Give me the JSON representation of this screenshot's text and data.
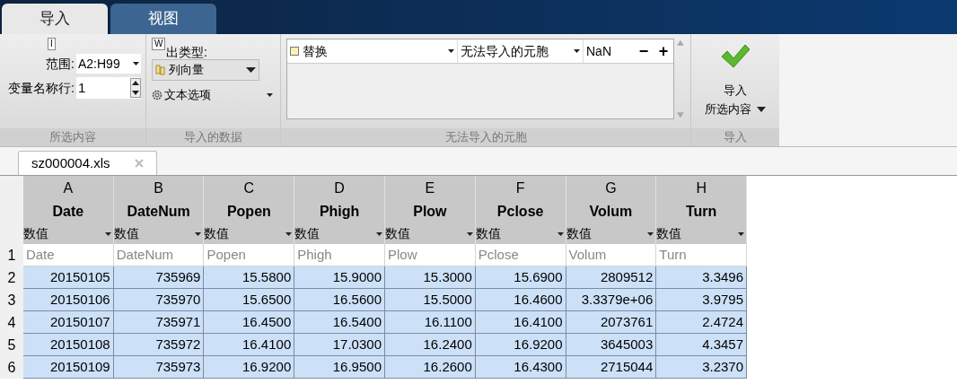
{
  "tabs": [
    {
      "label": "导入",
      "selected": true
    },
    {
      "label": "视图",
      "selected": false
    }
  ],
  "ribbon": {
    "selection": {
      "keytip": "I",
      "range_label": "范围:",
      "range_value": "A2:H99",
      "varrow_label": "变量名称行:",
      "varrow_value": "1",
      "group": "所选内容"
    },
    "imported": {
      "keytip": "W",
      "output_label": "出类型:",
      "output_value": "列向量",
      "text_options": "文本选项",
      "group": "导入的数据"
    },
    "unimportable": {
      "rule": {
        "checked": false,
        "action": "替换",
        "target": "无法导入的元胞",
        "value": "NaN"
      },
      "minus": "−",
      "plus": "+",
      "group": "无法导入的元胞"
    },
    "import": {
      "line1": "导入",
      "line2": "所选内容",
      "group": "导入"
    }
  },
  "document_tab": {
    "title": "sz000004.xls"
  },
  "table": {
    "columns": [
      {
        "letter": "A",
        "name": "Date",
        "type": "数值"
      },
      {
        "letter": "B",
        "name": "DateNum",
        "type": "数值"
      },
      {
        "letter": "C",
        "name": "Popen",
        "type": "数值"
      },
      {
        "letter": "D",
        "name": "Phigh",
        "type": "数值"
      },
      {
        "letter": "E",
        "name": "Plow",
        "type": "数值"
      },
      {
        "letter": "F",
        "name": "Pclose",
        "type": "数值"
      },
      {
        "letter": "G",
        "name": "Volum",
        "type": "数值"
      },
      {
        "letter": "H",
        "name": "Turn",
        "type": "数值"
      }
    ],
    "rows": [
      {
        "number": "1",
        "selected": false,
        "cells": [
          "Date",
          "DateNum",
          "Popen",
          "Phigh",
          "Plow",
          "Pclose",
          "Volum",
          "Turn"
        ]
      },
      {
        "number": "2",
        "selected": true,
        "cells": [
          "20150105",
          "735969",
          "15.5800",
          "15.9000",
          "15.3000",
          "15.6900",
          "2809512",
          "3.3496"
        ]
      },
      {
        "number": "3",
        "selected": true,
        "cells": [
          "20150106",
          "735970",
          "15.6500",
          "16.5600",
          "15.5000",
          "16.4600",
          "3.3379e+06",
          "3.9795"
        ]
      },
      {
        "number": "4",
        "selected": true,
        "cells": [
          "20150107",
          "735971",
          "16.4500",
          "16.5400",
          "16.1100",
          "16.4100",
          "2073761",
          "2.4724"
        ]
      },
      {
        "number": "5",
        "selected": true,
        "cells": [
          "20150108",
          "735972",
          "16.4100",
          "17.0300",
          "16.2400",
          "16.9200",
          "3645003",
          "4.3457"
        ]
      },
      {
        "number": "6",
        "selected": true,
        "cells": [
          "20150109",
          "735973",
          "16.9200",
          "16.9500",
          "16.2600",
          "16.4300",
          "2715044",
          "3.2370"
        ]
      }
    ]
  }
}
